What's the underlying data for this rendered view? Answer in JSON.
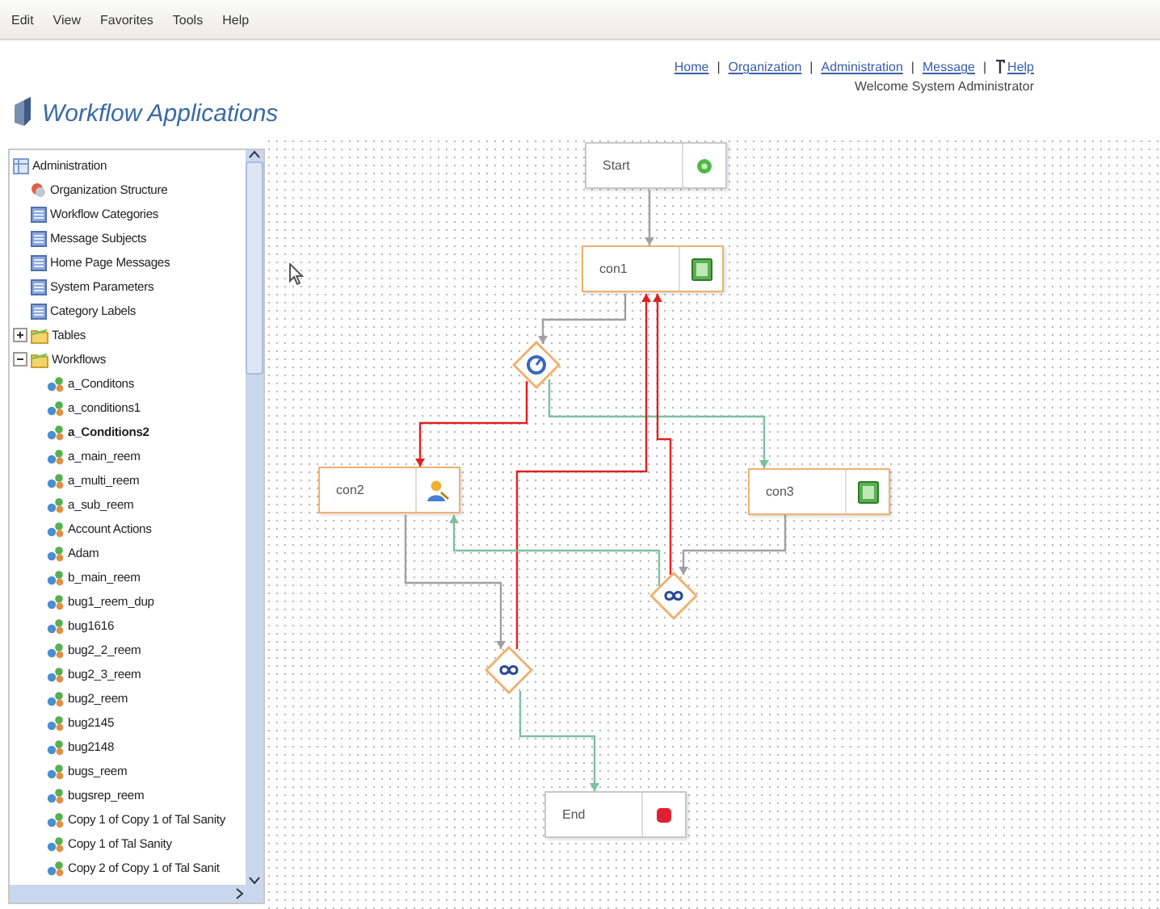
{
  "menu_bar": [
    "Edit",
    "View",
    "Favorites",
    "Tools",
    "Help"
  ],
  "header": {
    "title": "Workflow Applications",
    "nav": [
      {
        "kind": "link",
        "label": "Home"
      },
      {
        "kind": "separator",
        "label": "|"
      },
      {
        "kind": "link",
        "label": "Organization"
      },
      {
        "kind": "separator",
        "label": "|"
      },
      {
        "kind": "link",
        "label": "Administration"
      },
      {
        "kind": "separator",
        "label": "|"
      },
      {
        "kind": "link",
        "label": "Message"
      },
      {
        "kind": "separator",
        "label": "|"
      },
      {
        "kind": "help",
        "label": "Help"
      }
    ],
    "welcome": "Welcome System Administrator"
  },
  "sidebar": {
    "tree": [
      {
        "label": "Administration",
        "kind": "admin",
        "selected": false,
        "children": [
          {
            "label": "Organization Structure",
            "kind": "org",
            "selected": false
          },
          {
            "label": "Workflow Categories",
            "kind": "page",
            "selected": false
          },
          {
            "label": "Message Subjects",
            "kind": "page",
            "selected": false
          },
          {
            "label": "Home Page Messages",
            "kind": "page",
            "selected": false
          },
          {
            "label": "System Parameters",
            "kind": "page",
            "selected": false
          },
          {
            "label": "Category Labels",
            "kind": "page",
            "selected": false
          },
          {
            "label": "Tables",
            "kind": "folder",
            "selected": false,
            "expanded": false
          },
          {
            "label": "Workflows",
            "kind": "folder",
            "selected": false,
            "expanded": true,
            "children": [
              {
                "label": "a_Conditons",
                "kind": "workflow",
                "selected": false
              },
              {
                "label": "a_conditions1",
                "kind": "workflow",
                "selected": false
              },
              {
                "label": "a_Conditions2",
                "kind": "workflow",
                "selected": true
              },
              {
                "label": "a_main_reem",
                "kind": "workflow",
                "selected": false
              },
              {
                "label": "a_multi_reem",
                "kind": "workflow",
                "selected": false
              },
              {
                "label": "a_sub_reem",
                "kind": "workflow",
                "selected": false
              },
              {
                "label": "Account Actions",
                "kind": "workflow",
                "selected": false
              },
              {
                "label": "Adam",
                "kind": "workflow",
                "selected": false
              },
              {
                "label": "b_main_reem",
                "kind": "workflow",
                "selected": false
              },
              {
                "label": "bug1_reem_dup",
                "kind": "workflow",
                "selected": false
              },
              {
                "label": "bug1616",
                "kind": "workflow",
                "selected": false
              },
              {
                "label": "bug2_2_reem",
                "kind": "workflow",
                "selected": false
              },
              {
                "label": "bug2_3_reem",
                "kind": "workflow",
                "selected": false
              },
              {
                "label": "bug2_reem",
                "kind": "workflow",
                "selected": false
              },
              {
                "label": "bug2145",
                "kind": "workflow",
                "selected": false
              },
              {
                "label": "bug2148",
                "kind": "workflow",
                "selected": false
              },
              {
                "label": "bugs_reem",
                "kind": "workflow",
                "selected": false
              },
              {
                "label": "bugsrep_reem",
                "kind": "workflow",
                "selected": false
              },
              {
                "label": "Copy 1 of Copy 1 of Tal Sanity",
                "kind": "workflow",
                "selected": false
              },
              {
                "label": "Copy 1 of Tal Sanity",
                "kind": "workflow",
                "selected": false
              },
              {
                "label": "Copy 2 of Copy 1 of Tal Sanit",
                "kind": "workflow",
                "selected": false
              }
            ]
          }
        ]
      }
    ]
  },
  "diagram": {
    "nodes": [
      {
        "kind": "start",
        "label": "Start"
      },
      {
        "kind": "task",
        "label": "con1"
      },
      {
        "kind": "decision"
      },
      {
        "kind": "user",
        "label": "con2"
      },
      {
        "kind": "task",
        "label": "con3"
      },
      {
        "kind": "join"
      },
      {
        "kind": "join"
      },
      {
        "kind": "end",
        "label": "End"
      }
    ],
    "edges": [
      {
        "color": "#a0a0a0"
      },
      {
        "color": "#a0a0a0"
      },
      {
        "color": "#e02020"
      },
      {
        "color": "#7cc0a0"
      },
      {
        "color": "#e02020"
      },
      {
        "color": "#e02020"
      },
      {
        "color": "#a0a0a0"
      },
      {
        "color": "#a0a0a0"
      },
      {
        "color": "#7cc0a0"
      },
      {
        "color": "#7cc0a0"
      }
    ]
  }
}
